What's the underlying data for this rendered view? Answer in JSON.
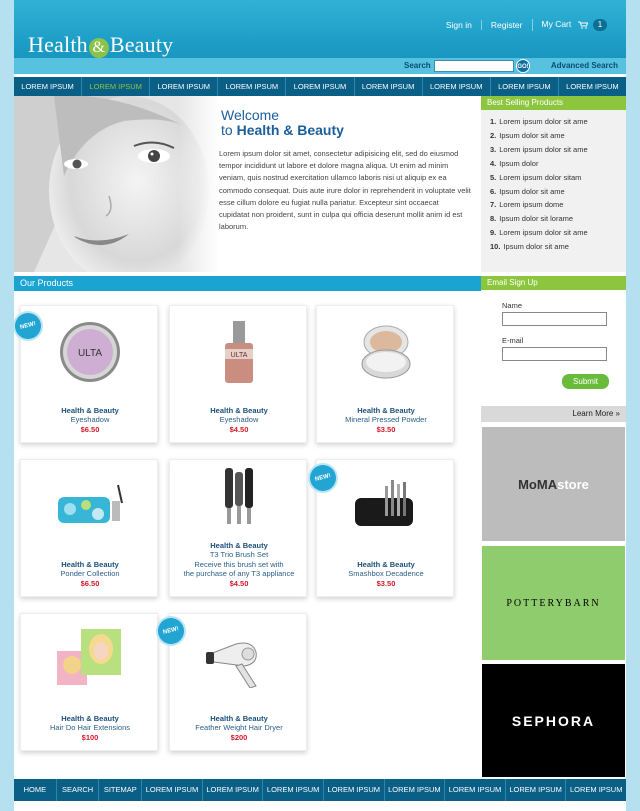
{
  "header": {
    "logo_left": "Health",
    "logo_amp": "&",
    "logo_right": "Beauty",
    "signin": "Sign in",
    "register": "Register",
    "cart": "My Cart",
    "cart_count": "1"
  },
  "search": {
    "label": "Search",
    "value": "",
    "go": "GO!",
    "advanced": "Advanced Search"
  },
  "topnav": [
    "LOREM IPSUM",
    "LOREM IPSUM",
    "LOREM IPSUM",
    "LOREM IPSUM",
    "LOREM IPSUM",
    "LOREM IPSUM",
    "LOREM IPSUM",
    "LOREM IPSUM",
    "LOREM IPSUM"
  ],
  "topnav_active_index": 1,
  "welcome": {
    "line1": "Welcome",
    "line2_prefix": "to ",
    "line2_bold": "Health & Beauty",
    "text": "Lorem ipsum dolor sit amet, consectetur adipisicing elit, sed do eiusmod tempor incididunt ut labore et dolore magna aliqua. Ut enim ad minim veniam, quis nostrud exercitation ullamco laboris nisi ut aliquip ex ea commodo consequat. Duis aute irure dolor in reprehenderit in voluptate velit esse cillum dolore eu fugiat nulla pariatur. Excepteur sint occaecat cupidatat non proident, sunt in culpa qui officia deserunt mollit anim id est laborum."
  },
  "best_selling": {
    "title": "Best Selling Products",
    "items": [
      {
        "num": "1.",
        "label": "Lorem ipsum dolor sit ame"
      },
      {
        "num": "2.",
        "label": "Ipsum dolor sit ame"
      },
      {
        "num": "3.",
        "label": "Lorem ipsum dolor sit ame"
      },
      {
        "num": "4.",
        "label": "Ipsum dolor"
      },
      {
        "num": "5.",
        "label": "Lorem ipsum dolor sitam"
      },
      {
        "num": "6.",
        "label": "Ipsum dolor sit ame"
      },
      {
        "num": "7.",
        "label": "Lorem ipsum dome"
      },
      {
        "num": "8.",
        "label": "Ipsum dolor sit lorame"
      },
      {
        "num": "9.",
        "label": "Lorem ipsum dolor sit ame"
      },
      {
        "num": "10.",
        "label": "Ipsum dolor sit ame"
      }
    ]
  },
  "products_title": "Our Products",
  "new_badge": "NEW!",
  "products": [
    {
      "brand": "Health & Beauty",
      "name": "Eyeshadow",
      "price": "$6.50",
      "new": true,
      "image_text": "ULTA",
      "icon": "eyeshadow-compact-icon"
    },
    {
      "brand": "Health & Beauty",
      "name": "Eyeshadow",
      "price": "$4.50",
      "new": false,
      "image_text": "ULTA",
      "icon": "nail-polish-icon"
    },
    {
      "brand": "Health & Beauty",
      "name": "Mineral Pressed Powder",
      "price": "$3.50",
      "new": false,
      "image_text": "",
      "icon": "powder-compact-icon"
    },
    {
      "brand": "Health & Beauty",
      "name": "Ponder Collection",
      "price": "$6.50",
      "new": false,
      "image_text": "",
      "icon": "cosmetic-bag-icon"
    },
    {
      "brand": "Health & Beauty",
      "name": "T3 Trio Brush Set",
      "extra1": "Receive this brush set with",
      "extra2": "the purchase of any T3 appliance",
      "price": "$4.50",
      "new": false,
      "image_text": "",
      "icon": "hair-brush-set-icon"
    },
    {
      "brand": "Health & Beauty",
      "name": "Smashbox Decadence",
      "price": "$3.50",
      "new": true,
      "image_text": "",
      "icon": "brush-case-icon"
    },
    {
      "brand": "Health & Beauty",
      "name": "Hair Do Hair Extensions",
      "price": "$100",
      "new": false,
      "image_text": "",
      "icon": "hair-extension-photo-icon"
    },
    {
      "brand": "Health & Beauty",
      "name": "Feather Weight Hair Dryer",
      "price": "$200",
      "new": true,
      "image_text": "",
      "icon": "hair-dryer-icon"
    }
  ],
  "email_signup": {
    "title": "Email Sign Up",
    "name_label": "Name",
    "email_label": "E-mail",
    "submit": "Submit",
    "learn_more": "Learn More »"
  },
  "ads": {
    "moma_main": "MoMA",
    "moma_store": "store",
    "pottery": "POTTERYBARN",
    "sephora": "SEPHORA"
  },
  "bottomnav": [
    "HOME",
    "SEARCH",
    "SITEMAP",
    "LOREM IPSUM",
    "LOREM IPSUM",
    "LOREM IPSUM",
    "LOREM IPSUM",
    "LOREM IPSUM",
    "LOREM IPSUM",
    "LOREM IPSUM",
    "LOREM IPSUM"
  ],
  "colors": {
    "header_blue": "#1c9dc6",
    "nav_blue": "#0a5f86",
    "accent_green": "#8cc63f",
    "price_red": "#d1192b"
  }
}
